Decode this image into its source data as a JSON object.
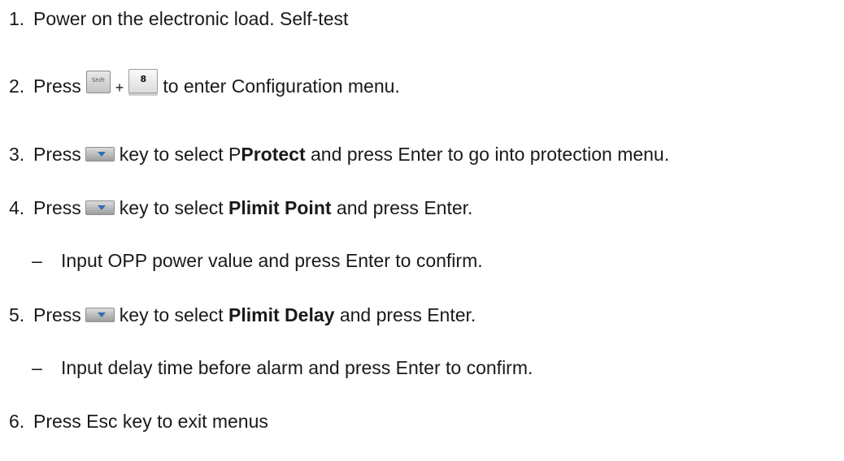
{
  "steps": [
    {
      "num": "1.",
      "text": "Power on the electronic load. Self-test"
    },
    {
      "num": "2.",
      "pre": "Press",
      "plus": "+",
      "post": "to enter Configuration menu.",
      "key1": "Shift",
      "key2": "8"
    },
    {
      "num": "3.",
      "pre": "Press",
      "mid": "key to select P",
      "bold": "Protect",
      "post": "and press Enter to go into protection menu."
    },
    {
      "num": "4.",
      "pre": "Press",
      "mid": "key to select",
      "bold": "Plimit Point",
      "post": "and press Enter.",
      "sub": {
        "dash": "–",
        "text": "Input OPP power value and press Enter to confirm."
      }
    },
    {
      "num": "5.",
      "pre": "Press",
      "mid": "key to select",
      "bold": "Plimit Delay",
      "post": "and press Enter.",
      "sub": {
        "dash": "–",
        "text": "Input delay time before alarm and press Enter to confirm."
      }
    },
    {
      "num": "6.",
      "text": "Press Esc key to exit menus"
    }
  ],
  "icons": {
    "shift_key": "shift-key-icon",
    "eight_key": "eight-key-icon",
    "down_key": "down-arrow-key-icon"
  }
}
